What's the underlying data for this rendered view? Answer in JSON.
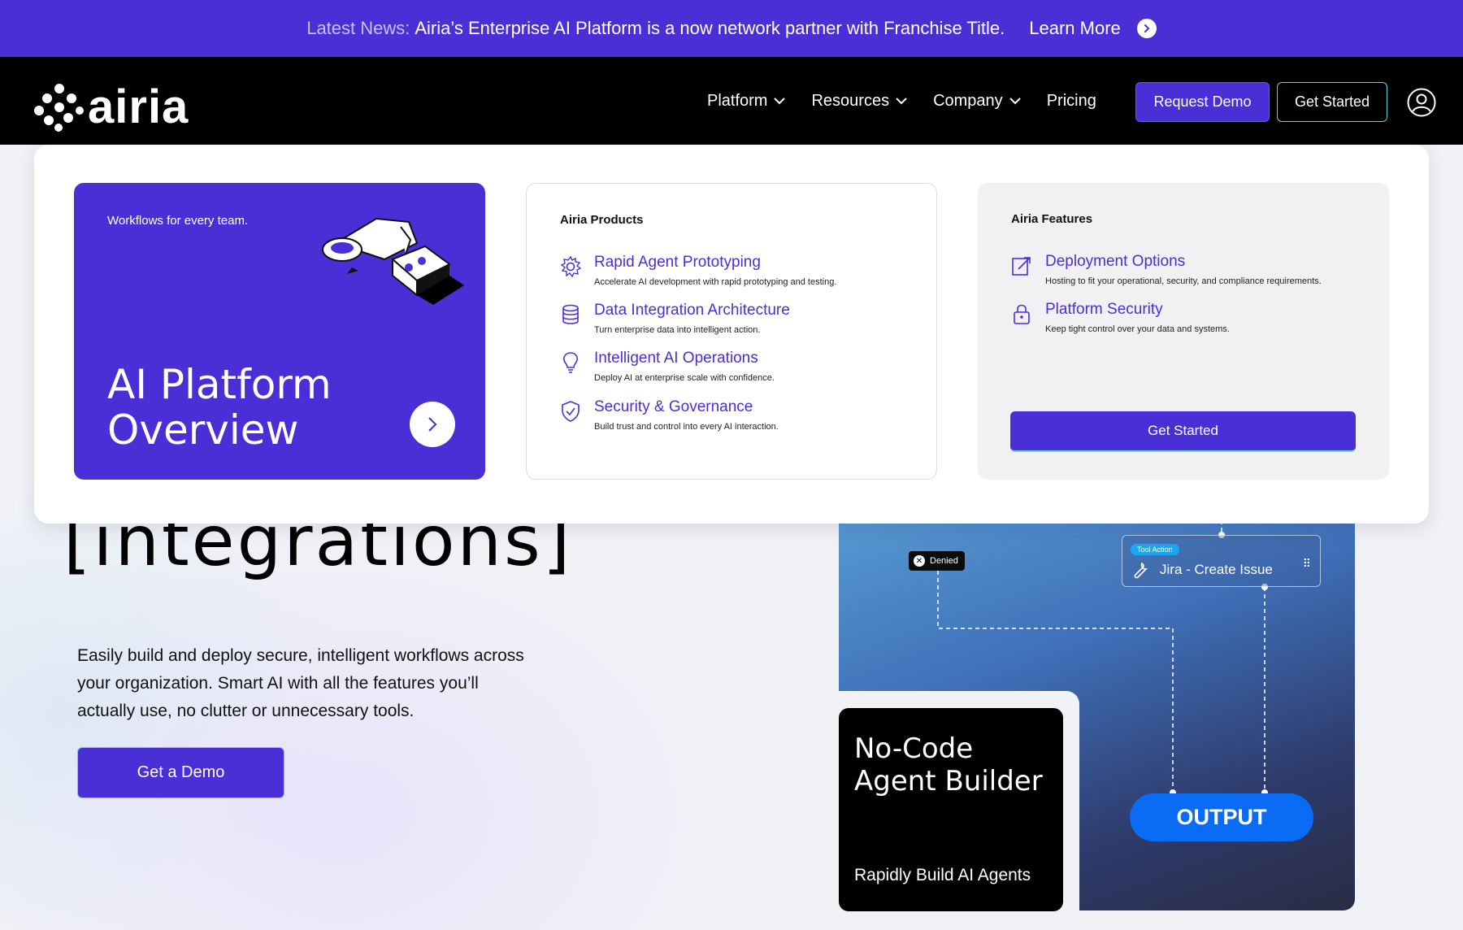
{
  "announcement": {
    "label": "Latest News:",
    "text": "Airia’s Enterprise AI Platform is a now network partner with Franchise Title.",
    "link": "Learn More"
  },
  "header": {
    "logo_text": "airia",
    "nav": [
      {
        "label": "Platform",
        "has_dropdown": true
      },
      {
        "label": "Resources",
        "has_dropdown": true
      },
      {
        "label": "Company",
        "has_dropdown": true
      },
      {
        "label": "Pricing",
        "has_dropdown": false
      }
    ],
    "request_demo": "Request Demo",
    "get_started": "Get Started"
  },
  "mega_menu": {
    "overview": {
      "kicker": "Workflows for every team.",
      "title_line1": "AI Platform",
      "title_line2": "Overview"
    },
    "products": {
      "heading": "Airia Products",
      "items": [
        {
          "title": "Rapid Agent Prototyping",
          "desc": "Accelerate AI development with rapid prototyping and testing.",
          "icon": "gear-icon"
        },
        {
          "title": "Data Integration Architecture",
          "desc": "Turn enterprise data into intelligent action.",
          "icon": "database-icon"
        },
        {
          "title": "Intelligent AI Operations",
          "desc": "Deploy AI at enterprise scale with confidence.",
          "icon": "lightbulb-icon"
        },
        {
          "title": "Security & Governance",
          "desc": "Build trust and control into every AI interaction.",
          "icon": "shield-check-icon"
        }
      ]
    },
    "features": {
      "heading": "Airia Features",
      "items": [
        {
          "title": "Deployment Options",
          "desc": "Hosting to fit your operational, security, and compliance requirements.",
          "icon": "deploy-icon"
        },
        {
          "title": "Platform Security",
          "desc": "Keep tight control over your data and systems.",
          "icon": "lock-icon"
        }
      ],
      "cta": "Get Started"
    }
  },
  "hero": {
    "title": "[integrations]",
    "description": "Easily build and deploy secure, intelligent workflows across your organization. Smart AI with all the features you’ll actually use, no clutter or unnecessary tools.",
    "cta": "Get a Demo"
  },
  "visual": {
    "denied": "Denied",
    "tool_badge": "Tool Action",
    "tool_label": "Jira - Create Issue",
    "card_title_line1": "No-Code",
    "card_title_line2": "Agent Builder",
    "card_subtitle": "Rapidly Build AI Agents",
    "output": "OUTPUT"
  },
  "colors": {
    "brand": "#4b2fd6",
    "accent_cyan": "#6ad0e8",
    "output_blue": "#0a6cf5"
  }
}
